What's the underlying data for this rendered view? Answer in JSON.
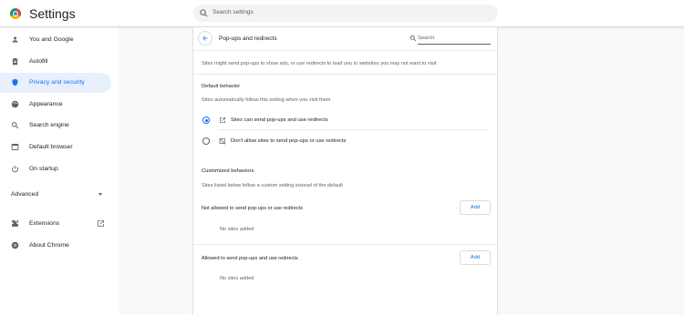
{
  "app": {
    "title": "Settings"
  },
  "search": {
    "placeholder": "Search settings"
  },
  "sidebar": {
    "items": [
      {
        "label": "You and Google"
      },
      {
        "label": "Autofill"
      },
      {
        "label": "Privacy and security"
      },
      {
        "label": "Appearance"
      },
      {
        "label": "Search engine"
      },
      {
        "label": "Default browser"
      },
      {
        "label": "On startup"
      }
    ],
    "advanced_label": "Advanced",
    "extensions_label": "Extensions",
    "about_label": "About Chrome"
  },
  "page": {
    "title": "Pop-ups and redirects",
    "search_placeholder": "Search",
    "description": "Sites might send pop-ups to show ads, or use redirects to lead you to websites you may not want to visit",
    "default_heading": "Default behavior",
    "default_sub": "Sites automatically follow this setting when you visit them",
    "options": [
      {
        "label": "Sites can send pop-ups and use redirects",
        "checked": true
      },
      {
        "label": "Don't allow sites to send pop-ups or use redirects",
        "checked": false
      }
    ],
    "custom_heading": "Customized behaviors",
    "custom_sub": "Sites listed below follow a custom setting instead of the default",
    "blocked_label": "Not allowed to send pop-ups or use redirects",
    "allowed_label": "Allowed to send pop-ups and use redirects",
    "add_label": "Add",
    "empty_label": "No sites added"
  },
  "colors": {
    "accent": "#1a73e8",
    "active_bg": "#e8f0fe"
  }
}
